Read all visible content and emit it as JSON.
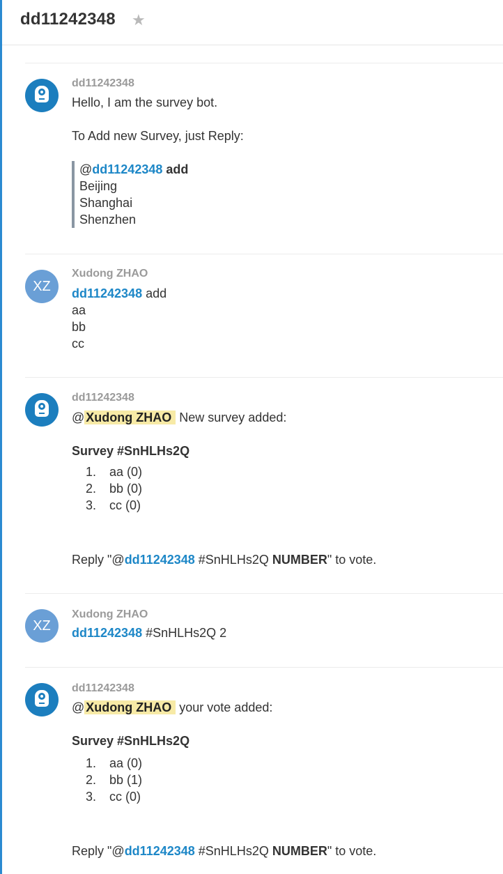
{
  "header": {
    "channel_title": "dd11242348",
    "star_icon": "star-icon"
  },
  "messages": [
    {
      "author": "dd11242348",
      "avatar": "bot-avatar",
      "lines": {
        "l1": "Hello, I am the survey bot.",
        "l2": "To Add new Survey, just Reply:"
      },
      "quote": {
        "at": "@",
        "mention": "dd11242348",
        "cmd": "add",
        "items": [
          "Beijing",
          "Shanghai",
          "Shenzhen"
        ]
      }
    },
    {
      "author": "Xudong ZHAO",
      "avatar_initials": "XZ",
      "mention": "dd11242348",
      "cmd": " add",
      "items": [
        "aa",
        "bb",
        "cc"
      ]
    },
    {
      "author": "dd11242348",
      "avatar": "bot-avatar",
      "at": "@",
      "mention_me": "Xudong ZHAO",
      "text": " New survey added:",
      "survey_title": "Survey #SnHLHs2Q",
      "options": [
        {
          "num": "1.",
          "label": "aa (0)"
        },
        {
          "num": "2.",
          "label": "bb (0)"
        },
        {
          "num": "3.",
          "label": "cc (0)"
        }
      ],
      "reply": {
        "pre": "Reply \"@",
        "mention": "dd11242348",
        "mid": " #SnHLHs2Q ",
        "bold": "NUMBER",
        "post": "\" to vote."
      }
    },
    {
      "author": "Xudong ZHAO",
      "avatar_initials": "XZ",
      "mention": "dd11242348",
      "text": " #SnHLHs2Q 2"
    },
    {
      "author": "dd11242348",
      "avatar": "bot-avatar",
      "at": "@",
      "mention_me": "Xudong ZHAO",
      "text": " your vote added:",
      "survey_title": "Survey #SnHLHs2Q",
      "options": [
        {
          "num": "1.",
          "label": "aa (0)"
        },
        {
          "num": "2.",
          "label": "bb (1)"
        },
        {
          "num": "3.",
          "label": "cc (0)"
        }
      ],
      "reply": {
        "pre": "Reply \"@",
        "mention": "dd11242348",
        "mid": " #SnHLHs2Q ",
        "bold": "NUMBER",
        "post": "\" to vote."
      }
    }
  ]
}
